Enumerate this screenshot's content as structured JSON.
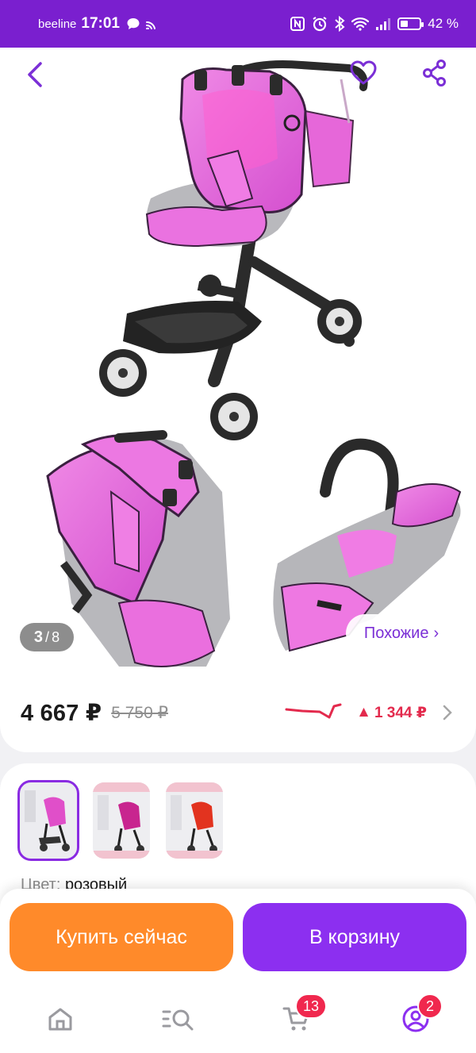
{
  "status_bar": {
    "carrier": "beeline",
    "time": "17:01",
    "battery": "42 %",
    "battery_level": 0.42,
    "icons": [
      "chat-icon",
      "cast-icon",
      "nfc-icon",
      "alarm-icon",
      "bluetooth-icon",
      "wifi-icon",
      "signal-icon",
      "battery-icon"
    ]
  },
  "header": {
    "icons": [
      "back-icon",
      "heart-icon",
      "share-icon"
    ]
  },
  "gallery": {
    "current": "3",
    "separator": "/",
    "total": "8",
    "similar_label": "Похожие",
    "similar_arrow": "›"
  },
  "price": {
    "current": "4 667 ₽",
    "old": "5 750 ₽",
    "change_arrow": "▲",
    "change": "1 344 ₽"
  },
  "variants": {
    "color_label": "Цвет:",
    "color_value": "розовый",
    "thumbnails": [
      "pink",
      "dark-pink",
      "red"
    ]
  },
  "actions": {
    "buy_now": "Купить сейчас",
    "add_to_cart": "В корзину"
  },
  "nav": {
    "items": [
      "home-icon",
      "catalog-search-icon",
      "cart-icon",
      "profile-icon"
    ],
    "cart_badge": "13",
    "profile_badge": "2"
  },
  "colors": {
    "accent": "#8c2ff0",
    "status_bar": "#7a1fcf",
    "buy_button": "#ff8a2a",
    "price_up": "#e32a4d"
  }
}
